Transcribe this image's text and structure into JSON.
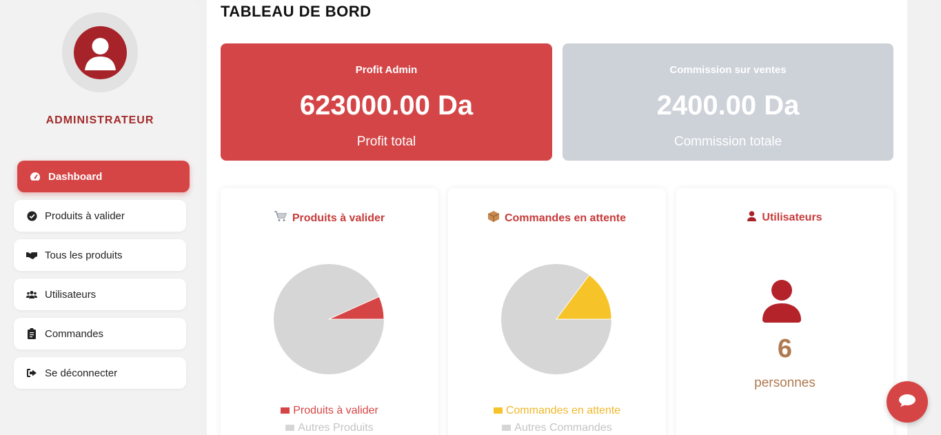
{
  "sidebar": {
    "role": "ADMINISTRATEUR",
    "items": [
      {
        "label": "Dashboard",
        "icon": "gauge-icon"
      },
      {
        "label": "Produits à valider",
        "icon": "check-circle-icon"
      },
      {
        "label": "Tous les produits",
        "icon": "handshake-icon"
      },
      {
        "label": "Utilisateurs",
        "icon": "users-icon"
      },
      {
        "label": "Commandes",
        "icon": "clipboard-icon"
      },
      {
        "label": "Se déconnecter",
        "icon": "sign-out-icon"
      }
    ]
  },
  "main": {
    "title": "TABLEAU DE BORD",
    "cards": [
      {
        "title": "Profit Admin",
        "value": "623000.00 Da",
        "subtitle": "Profit total",
        "color": "#d44547"
      },
      {
        "title": "Commission sur ventes",
        "value": "2400.00 Da",
        "subtitle": "Commission totale",
        "color": "#cdd1d8"
      }
    ],
    "panels": [
      {
        "title": "Produits à valider",
        "icon": "cart-icon",
        "legend": [
          {
            "label": "Produits à valider",
            "color": "#d64545"
          },
          {
            "label": "Autres Produits",
            "color": "#d6d6d6"
          }
        ],
        "slice_fraction": 0.067
      },
      {
        "title": "Commandes en attente",
        "icon": "package-icon",
        "legend": [
          {
            "label": "Commandes en attente",
            "color": "#f6c328"
          },
          {
            "label": "Autres Commandes",
            "color": "#d6d6d6"
          }
        ],
        "slice_fraction": 0.148
      },
      {
        "title": "Utilisateurs",
        "icon": "user-icon",
        "count": "6",
        "count_label": "personnes"
      }
    ]
  },
  "colors": {
    "accent": "#d64545",
    "dark_red": "#a7232a",
    "grey_card": "#cdd1d8",
    "pie_grey": "#d6d6d6",
    "yellow": "#f6c328",
    "brown": "#b07a50"
  }
}
